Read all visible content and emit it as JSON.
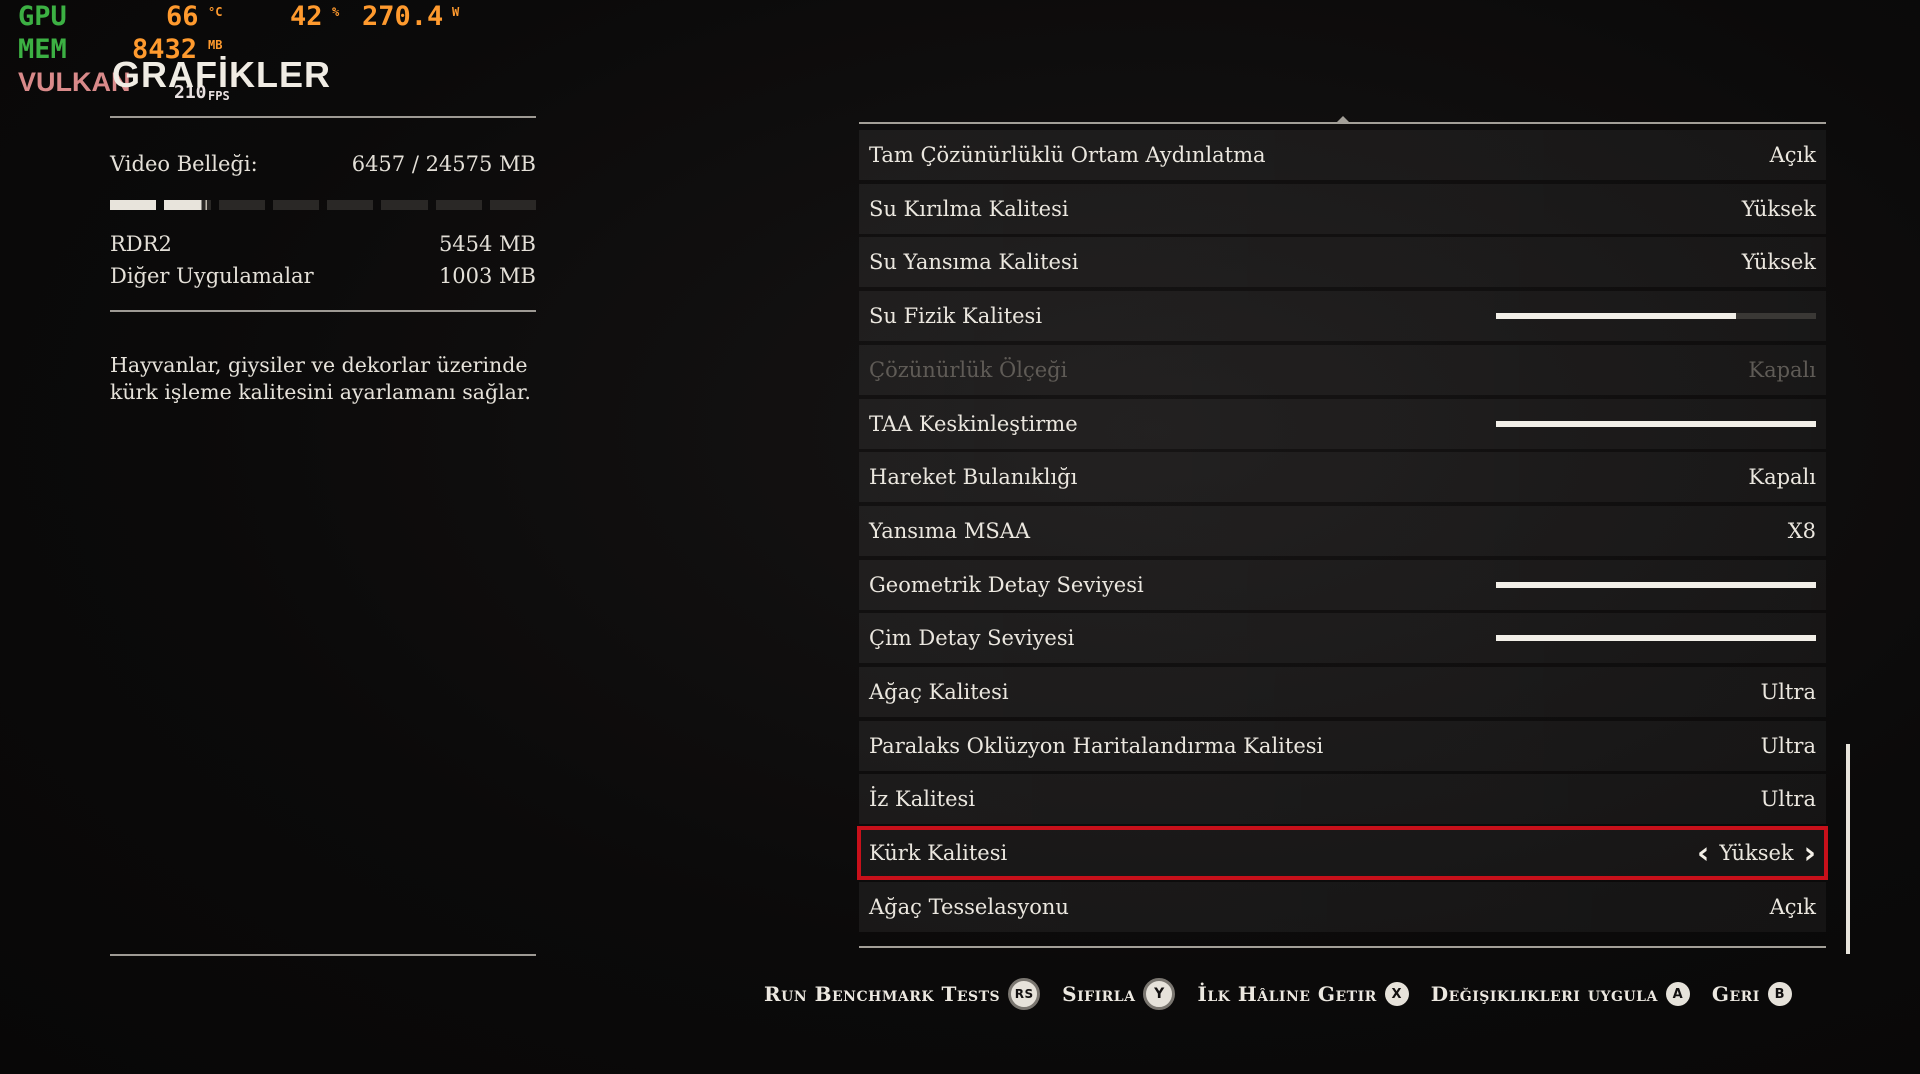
{
  "overlay": {
    "gpu": {
      "label": "GPU",
      "temp": "66",
      "temp_unit": "°C",
      "load": "42",
      "load_unit": "%",
      "power": "270.4",
      "power_unit": "W"
    },
    "mem": {
      "label": "MEM",
      "value": "8432",
      "unit": "MB"
    },
    "api": {
      "label": "VULKAN",
      "fps": "210",
      "fps_unit": "FPS"
    }
  },
  "page_title": "GRAFİKLER",
  "left_panel": {
    "vram_label": "Video Belleği:",
    "vram_value": "6457  / 24575  MB",
    "vram_used_fraction": 0.263,
    "apps": [
      {
        "name": "RDR2",
        "value": "5454  MB"
      },
      {
        "name": "Diğer Uygulamalar",
        "value": "1003  MB"
      }
    ],
    "description": "Hayvanlar, giysiler ve dekorlar üzerinde kürk işleme kalitesini ayarlamanı sağlar."
  },
  "settings": [
    {
      "label": "Tam Çözünürlüklü Ortam Aydınlatma",
      "value": "Açık"
    },
    {
      "label": "Su Kırılma Kalitesi",
      "value": "Yüksek"
    },
    {
      "label": "Su Yansıma Kalitesi",
      "value": "Yüksek"
    },
    {
      "label": "Su Fizik Kalitesi",
      "slider": 0.75
    },
    {
      "label": "Çözünürlük Ölçeği",
      "value": "Kapalı",
      "disabled": true
    },
    {
      "label": "TAA Keskinleştirme",
      "slider": 1.0
    },
    {
      "label": "Hareket Bulanıklığı",
      "value": "Kapalı"
    },
    {
      "label": "Yansıma MSAA",
      "value": "X8"
    },
    {
      "label": "Geometrik Detay Seviyesi",
      "slider": 1.0
    },
    {
      "label": "Çim Detay Seviyesi",
      "slider": 1.0
    },
    {
      "label": "Ağaç Kalitesi",
      "value": "Ultra"
    },
    {
      "label": "Paralaks Oklüzyon Haritalandırma Kalitesi",
      "value": "Ultra"
    },
    {
      "label": "İz Kalitesi",
      "value": "Ultra"
    },
    {
      "label": "Kürk Kalitesi",
      "value": "Yüksek",
      "selected": true
    },
    {
      "label": "Ağaç Tesselasyonu",
      "value": "Açık"
    }
  ],
  "footer": {
    "run_benchmark": "Run Benchmark Tests",
    "run_benchmark_key": "RS",
    "reset": "Sıfırla",
    "reset_key": "Y",
    "restore": "İlk Hâline Getir",
    "restore_key": "X",
    "apply": "Değişiklikleri uygula",
    "apply_key": "A",
    "back": "Geri",
    "back_key": "B"
  },
  "colors": {
    "highlight": "#c8101a",
    "gpu_label": "#3cb043",
    "overlay_value": "#ff9a2e"
  }
}
